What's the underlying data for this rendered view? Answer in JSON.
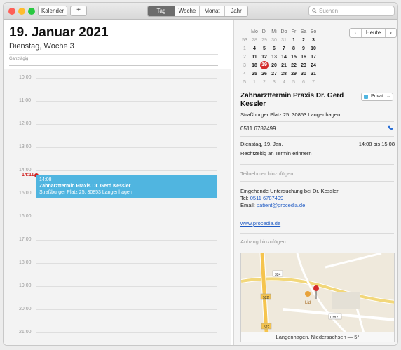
{
  "toolbar": {
    "calendars_label": "Kalender",
    "add_label": "+",
    "views": [
      {
        "label": "Tag",
        "active": true
      },
      {
        "label": "Woche",
        "active": false
      },
      {
        "label": "Monat",
        "active": false
      },
      {
        "label": "Jahr",
        "active": false
      }
    ],
    "search_placeholder": "Suchen"
  },
  "day": {
    "title": "19. Januar 2021",
    "subtitle": "Dienstag, Woche 3",
    "allday_label": "Ganztägig",
    "hours": [
      "10:00",
      "11:00",
      "12:00",
      "13:00",
      "14:00",
      "15:00",
      "16:00",
      "17:00",
      "18:00",
      "19:00",
      "20:00",
      "21:00"
    ],
    "now_label": "14:11",
    "event": {
      "time": "14:08",
      "title": "Zahnarzttermin Praxis Dr. Gerd Kessler",
      "location": "Straßburger Platz 25, 30853 Langenhagen",
      "color": "#50b5e0"
    }
  },
  "mini_calendar": {
    "weekdays": [
      "Mo",
      "Di",
      "Mi",
      "Do",
      "Fr",
      "Sa",
      "So"
    ],
    "today_button": "Heute",
    "prev_icon": "‹",
    "next_icon": "›",
    "rows": [
      {
        "week": "53",
        "days": [
          "28",
          "29",
          "30",
          "31",
          "1",
          "2",
          "3"
        ],
        "grey": [
          0,
          1,
          2,
          3
        ]
      },
      {
        "week": "1",
        "days": [
          "4",
          "5",
          "6",
          "7",
          "8",
          "9",
          "10"
        ],
        "grey": []
      },
      {
        "week": "2",
        "days": [
          "11",
          "12",
          "13",
          "14",
          "15",
          "16",
          "17"
        ],
        "grey": []
      },
      {
        "week": "3",
        "days": [
          "18",
          "19",
          "20",
          "21",
          "22",
          "23",
          "24"
        ],
        "grey": [],
        "today": 1
      },
      {
        "week": "4",
        "days": [
          "25",
          "26",
          "27",
          "28",
          "29",
          "30",
          "31"
        ],
        "grey": []
      },
      {
        "week": "5",
        "days": [
          "1",
          "2",
          "3",
          "4",
          "5",
          "6",
          "7"
        ],
        "grey": [
          0,
          1,
          2,
          3,
          4,
          5,
          6
        ]
      }
    ],
    "today_color": "#d42b2b"
  },
  "detail": {
    "title": "Zahnarzttermin Praxis Dr. Gerd Kessler",
    "calendar": "Privat",
    "address": "Straßburger Platz 25, 30853 Langenhagen",
    "phone": "0511 6787499",
    "date": "Dienstag, 19. Jan.",
    "time": "14:08 bis 15:08",
    "alert": "Rechtzeitig an Termin erinnern",
    "participants_placeholder": "Teilnehmer hinzufügen",
    "notes_line1": "Eingehende Untersuchung bei Dr. Kessler",
    "tel_prefix": "Tel: ",
    "tel_link": "0511 6787499",
    "email_prefix": "Email: ",
    "email_link": "patient@procedia.de",
    "url": "www.procedia.de",
    "attachment_placeholder": "Anhang hinzufügen ...",
    "map_caption": "Langenhagen, Niedersachsen — 5°",
    "map_labels": {
      "road1": "324",
      "road2": "522",
      "road3": "522",
      "road4": "L382",
      "shop": "Lidl"
    }
  }
}
